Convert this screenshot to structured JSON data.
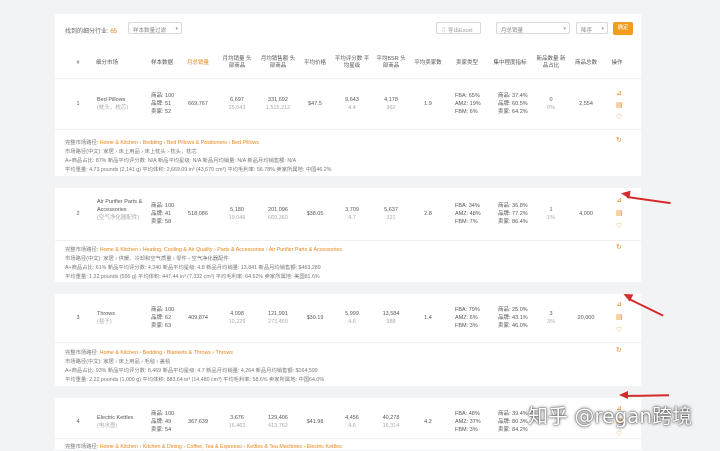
{
  "toolbar": {
    "result_prefix": "找到的细分行业:",
    "result_count": "65",
    "sample_select": "样本数量过滤",
    "export_label": "导出Excel",
    "sort_field": "月总销量",
    "sort_order": "降序",
    "confirm_label": "确定"
  },
  "headers": {
    "idx": "#",
    "market": "细分市场",
    "sample": "样本数据",
    "monthly_sales": "月总销量",
    "monthly_top": "月均销量 头部商品",
    "monthly_gmv": "月均销售额 头部商品",
    "avg_price": "平均价格",
    "avg_rating": "平均评分数 平均星级",
    "avg_bsr": "平均BSR 头部商品",
    "avg_sellers": "平均卖家数",
    "seller_type": "卖家类型",
    "concentration": "集中程度指标",
    "new_products": "新品数量 新品占比",
    "total_products": "商品总数",
    "actions": "操作"
  },
  "rows": [
    {
      "idx": "1",
      "name_en": "Bed Pillows",
      "name_cn": "(枕头，枕芯)",
      "sample": [
        "商品: 100",
        "品牌: 51",
        "卖家: 52"
      ],
      "monthly_sales": "669,767",
      "top_sales": [
        "6,697",
        "25,043"
      ],
      "top_gmv": [
        "331,692",
        "1,515,212"
      ],
      "avg_price": "$47.5",
      "rating": [
        "9,643",
        "4.4"
      ],
      "bsr": [
        "4,178",
        "362"
      ],
      "sellers": "1.9",
      "seller_type": [
        "FBA: 65%",
        "AMZ: 19%",
        "FBM: 6%"
      ],
      "concentration": [
        "商品: 37.4%",
        "品牌: 60.5%",
        "卖家: 64.2%"
      ],
      "new": [
        "0",
        "0%"
      ],
      "total": "2,554",
      "path_label": "完整市场路径:",
      "path": "Home & Kitchen › Bedding › Bed Pillows & Positioners › Bed Pillows",
      "cn_label": "市场路径(中文):",
      "cn_path": "家居 › 床上用品 › 床上枕头 › 枕头，枕芯",
      "line3": "A+商品占比: 87%   新品平均评分数: N/A   新品平均星级: N/A   新品月均销量: N/A   新品月均销售额: N/A",
      "line4": "平均重量: 4.73 pounds (2,141 g)   平均体积: 2,669.09 in³ (43,670 cm³)   平均毛利率: 56.78%   卖家所属地: 中国46.2%"
    },
    {
      "idx": "2",
      "name_en": "Air Purifier Parts & Accessories",
      "name_cn": "(空气净化器配件)",
      "sample": [
        "商品: 100",
        "品牌: 41",
        "卖家: 58"
      ],
      "monthly_sales": "518,086",
      "top_sales": [
        "5,180",
        "19,046"
      ],
      "top_gmv": [
        "201,096",
        "669,360"
      ],
      "avg_price": "$38.05",
      "rating": [
        "3,709",
        "4.7"
      ],
      "bsr": [
        "5,637",
        "321"
      ],
      "sellers": "2.8",
      "seller_type": [
        "FBA: 34%",
        "AMZ: 48%",
        "FBM: 7%"
      ],
      "concentration": [
        "商品: 36.8%",
        "品牌: 77.2%",
        "卖家: 86.4%"
      ],
      "new": [
        "1",
        "1%"
      ],
      "total": "4,000",
      "path_label": "完整市场路径:",
      "path": "Home & Kitchen › Heating, Cooling & Air Quality › Parts & Accessories › Air Purifier Parts & Accessories",
      "cn_label": "市场路径(中文):",
      "cn_path": "家居 › 供暖、冷却和空气质量 › 零件 › 空气净化器配件",
      "line3": "A+商品占比: 61%   新品平均评分数: 4,340   新品平均星级: 4.8   新品月均销量: 13,841   新品月均销售额: $463,289",
      "line4": "平均重量: 1.22 pounds (556 g)   平均体积: 447.44 in³ (7,332 cm³)   平均毛利率: 64.62%   卖家所属地: 美国81.6%"
    },
    {
      "idx": "3",
      "name_en": "Throws",
      "name_cn": "(毯子)",
      "sample": [
        "商品: 100",
        "品牌: 62",
        "卖家: 63"
      ],
      "monthly_sales": "409,874",
      "top_sales": [
        "4,098",
        "10,229"
      ],
      "top_gmv": [
        "121,991",
        "273,459"
      ],
      "avg_price": "$30.19",
      "rating": [
        "5,999",
        "4.6"
      ],
      "bsr": [
        "13,584",
        "988"
      ],
      "sellers": "1.4",
      "seller_type": [
        "FBA: 79%",
        "AMZ: 6%",
        "FBM: 3%"
      ],
      "concentration": [
        "商品: 25.0%",
        "品牌: 43.1%",
        "卖家: 46.0%"
      ],
      "new": [
        "3",
        "3%"
      ],
      "total": "20,000",
      "path_label": "完整市场路径:",
      "path": "Home & Kitchen › Bedding › Blankets & Throws › Throws",
      "cn_label": "市场路径(中文):",
      "cn_path": "家居 › 床上用品 › 毛毯 › 盖毯",
      "line3": "A+商品占比: 93%   新品平均评分数: 8,469   新品平均星级: 4.7   新品月均销量: 4,264   新品月均销售额: $164,599",
      "line4": "平均重量: 2.22 pounds (1,009 g)   平均体积: 883.64 in³ (14,480 cm³)   平均毛利率: 58.6%   卖家所属地: 中国64.0%"
    },
    {
      "idx": "4",
      "name_en": "Electric Kettles",
      "name_cn": "(电水壶)",
      "sample": [
        "商品: 100",
        "品牌: 49",
        "卖家: 54"
      ],
      "monthly_sales": "367,639",
      "top_sales": [
        "3,676",
        "16,462"
      ],
      "top_gmv": [
        "129,406",
        "413,762"
      ],
      "avg_price": "$41.98",
      "rating": [
        "4,456",
        "4.6"
      ],
      "bsr": [
        "40,278",
        "16,314"
      ],
      "sellers": "4.2",
      "seller_type": [
        "FBA: 48%",
        "AMZ: 37%",
        "FBM: 3%"
      ],
      "concentration": [
        "商品: 39.4%",
        "品牌: 80.3%",
        "卖家: 84.2%"
      ],
      "new": [
        "",
        ""
      ],
      "total": "",
      "path_label": "完整市场路径:",
      "path": "Home & Kitchen › Kitchen & Dining › Coffee, Tea & Espresso › Kettles & Tea Machines › Electric Kettles",
      "cn_label": "",
      "cn_path": "",
      "line3": "",
      "line4": ""
    }
  ],
  "watermark": "知乎 @regan跨境",
  "colors": {
    "accent": "#e8841a",
    "confirm": "#f39c1f",
    "arrow": "#d42a2a"
  }
}
